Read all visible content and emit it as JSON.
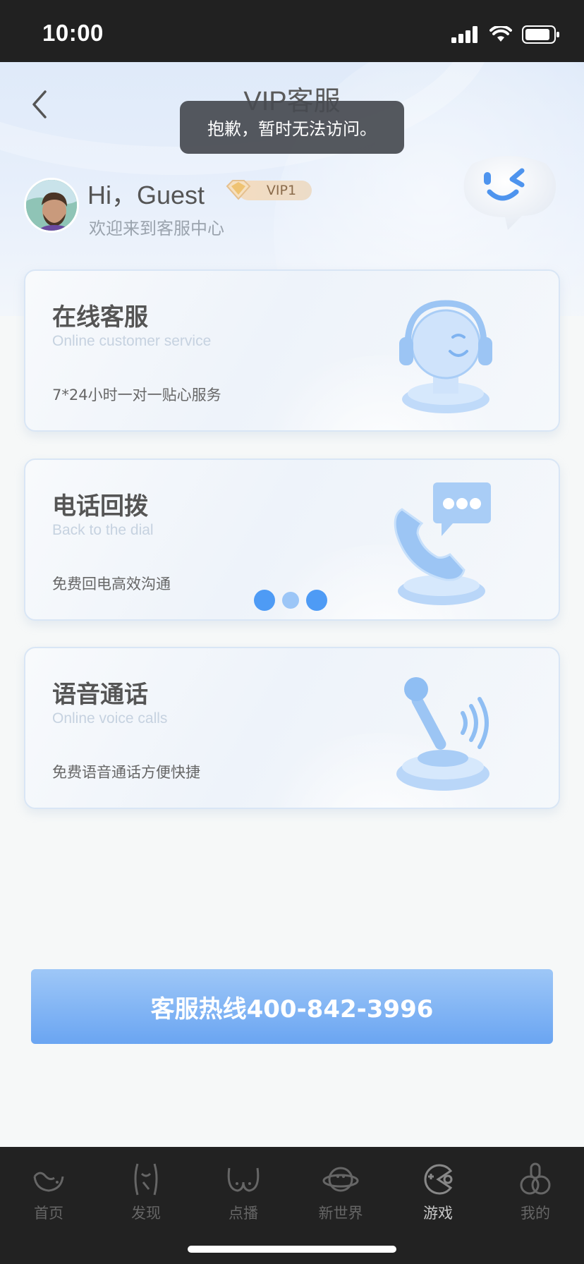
{
  "status_bar": {
    "time": "10:00"
  },
  "header": {
    "title": "VIP客服"
  },
  "toast": {
    "message": "抱歉，暂时无法访问。"
  },
  "user": {
    "greeting": "Hi，Guest",
    "vip_level": "VIP1",
    "welcome": "欢迎来到客服中心"
  },
  "services": [
    {
      "title": "在线客服",
      "subtitle": "Online customer service",
      "description": "7*24小时一对一贴心服务"
    },
    {
      "title": "电话回拨",
      "subtitle": "Back to the dial",
      "description": "免费回电高效沟通"
    },
    {
      "title": "语音通话",
      "subtitle": "Online voice calls",
      "description": "免费语音通话方便快捷"
    }
  ],
  "hotline": {
    "label": "客服热线400-842-3996"
  },
  "tabs": [
    {
      "label": "首页",
      "icon": "home-icon"
    },
    {
      "label": "发现",
      "icon": "discover-icon"
    },
    {
      "label": "点播",
      "icon": "on-demand-icon"
    },
    {
      "label": "新世界",
      "icon": "planet-icon"
    },
    {
      "label": "游戏",
      "icon": "game-icon",
      "active": true
    },
    {
      "label": "我的",
      "icon": "profile-icon"
    }
  ],
  "colors": {
    "accent": "#4e9bf5",
    "button_top": "#9ec7f7",
    "button_bottom": "#6aa5f2",
    "tab_bar": "#222222"
  }
}
